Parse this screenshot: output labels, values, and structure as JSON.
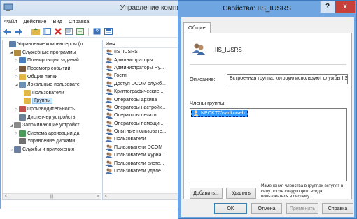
{
  "mmc": {
    "title": "Управление компью",
    "menu": [
      "Файл",
      "Действие",
      "Вид",
      "Справка"
    ],
    "tree": [
      {
        "label": "Управление компьютером (л",
        "indent": 0,
        "arrow": "",
        "icon": "computer-icon",
        "color": "#5b7fa8"
      },
      {
        "label": "Служебные программы",
        "indent": 1,
        "arrow": "◢",
        "icon": "tools-icon",
        "color": "#b08a3e"
      },
      {
        "label": "Планировщик заданий",
        "indent": 2,
        "arrow": "▷",
        "icon": "clock-icon",
        "color": "#4a7fbf"
      },
      {
        "label": "Просмотр событий",
        "indent": 2,
        "arrow": "▷",
        "icon": "event-viewer-icon",
        "color": "#7a5a3a"
      },
      {
        "label": "Общие папки",
        "indent": 2,
        "arrow": "▷",
        "icon": "folder-icon",
        "color": "#e3b64a"
      },
      {
        "label": "Локальные пользовате",
        "indent": 2,
        "arrow": "◢",
        "icon": "users-icon",
        "color": "#6c8fb5"
      },
      {
        "label": "Пользователи",
        "indent": 3,
        "arrow": "",
        "icon": "folder-icon",
        "color": "#e3b64a"
      },
      {
        "label": "Группы",
        "indent": 3,
        "arrow": "",
        "icon": "folder-icon",
        "color": "#e3b64a",
        "selected": true
      },
      {
        "label": "Производительность",
        "indent": 2,
        "arrow": "▷",
        "icon": "performance-icon",
        "color": "#c0504d"
      },
      {
        "label": "Диспетчер устройств",
        "indent": 2,
        "arrow": "",
        "icon": "device-manager-icon",
        "color": "#6d7f95"
      },
      {
        "label": "Запоминающие устройст",
        "indent": 1,
        "arrow": "◢",
        "icon": "storage-icon",
        "color": "#8a8a8a"
      },
      {
        "label": "Система архивации да",
        "indent": 2,
        "arrow": "▷",
        "icon": "backup-icon",
        "color": "#4c9a5a"
      },
      {
        "label": "Управление дисками",
        "indent": 2,
        "arrow": "",
        "icon": "disk-icon",
        "color": "#707070"
      },
      {
        "label": "Службы и приложения",
        "indent": 1,
        "arrow": "▷",
        "icon": "services-icon",
        "color": "#6a7fa0"
      }
    ],
    "list_header": "Имя",
    "list_items": [
      "IIS_IUSRS",
      "Администраторы",
      "Администраторы Ну...",
      "Гости",
      "Доступ DCOM служб...",
      "Криптографические ...",
      "Операторы архива",
      "Операторы настройк...",
      "Операторы печати",
      "Операторы помощи ...",
      "Опытные пользовате...",
      "Пользователи",
      "Пользователи DCOM",
      "Пользователи журна...",
      "Пользователи систе...",
      "Пользователи удале..."
    ]
  },
  "dialog": {
    "title": "Свойства: IIS_IUSRS",
    "help_label": "?",
    "close_label": "x",
    "tab_general": "Общие",
    "group_name": "IIS_IUSRS",
    "description_label": "Описание:",
    "description_value": "Встроенная группа, которую используют службы IIS.",
    "members_label": "Члены группы:",
    "members": [
      "NPOKTC\\sadkoweb"
    ],
    "add_label": "Добавить...",
    "remove_label": "Удалить",
    "note": "Изменения членства в группах вступят в силу после следующего входа пользователя в систему.",
    "ok_label": "OK",
    "cancel_label": "Отмена",
    "apply_label": "Применить",
    "help_button_label": "Справка"
  }
}
